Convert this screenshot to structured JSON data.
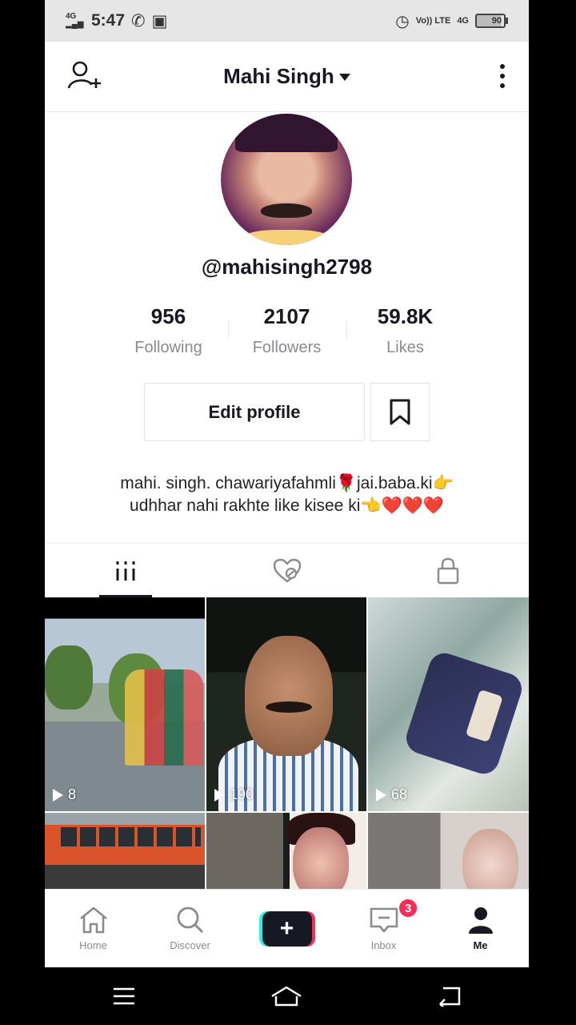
{
  "status_bar": {
    "network": "4G",
    "time": "5:47",
    "volte": "Vo)) LTE",
    "network2": "4G",
    "battery": "90"
  },
  "header": {
    "title": "Mahi Singh"
  },
  "profile": {
    "username": "@mahisingh2798",
    "stats": [
      {
        "value": "956",
        "label": "Following"
      },
      {
        "value": "2107",
        "label": "Followers"
      },
      {
        "value": "59.8K",
        "label": "Likes"
      }
    ],
    "edit_label": "Edit profile",
    "bio_line1": "mahi. singh. chawariyafahmli🌹jai.baba.ki👉",
    "bio_line2": "udhhar nahi rakhte like kisee ki👈❤️❤️❤️"
  },
  "tabs": [
    {
      "icon": "grid-icon",
      "active": true
    },
    {
      "icon": "liked-icon",
      "active": false
    },
    {
      "icon": "lock-icon",
      "active": false
    }
  ],
  "videos": [
    {
      "views": "8"
    },
    {
      "views": "190"
    },
    {
      "views": "68"
    },
    {
      "views": ""
    },
    {
      "views": ""
    },
    {
      "views": ""
    }
  ],
  "bottom_nav": {
    "home": "Home",
    "discover": "Discover",
    "inbox": "Inbox",
    "inbox_badge": "3",
    "me": "Me"
  },
  "colors": {
    "accent": "#fe2c55",
    "accent2": "#25f4ee",
    "text": "#161823",
    "muted": "#8a8b91"
  }
}
